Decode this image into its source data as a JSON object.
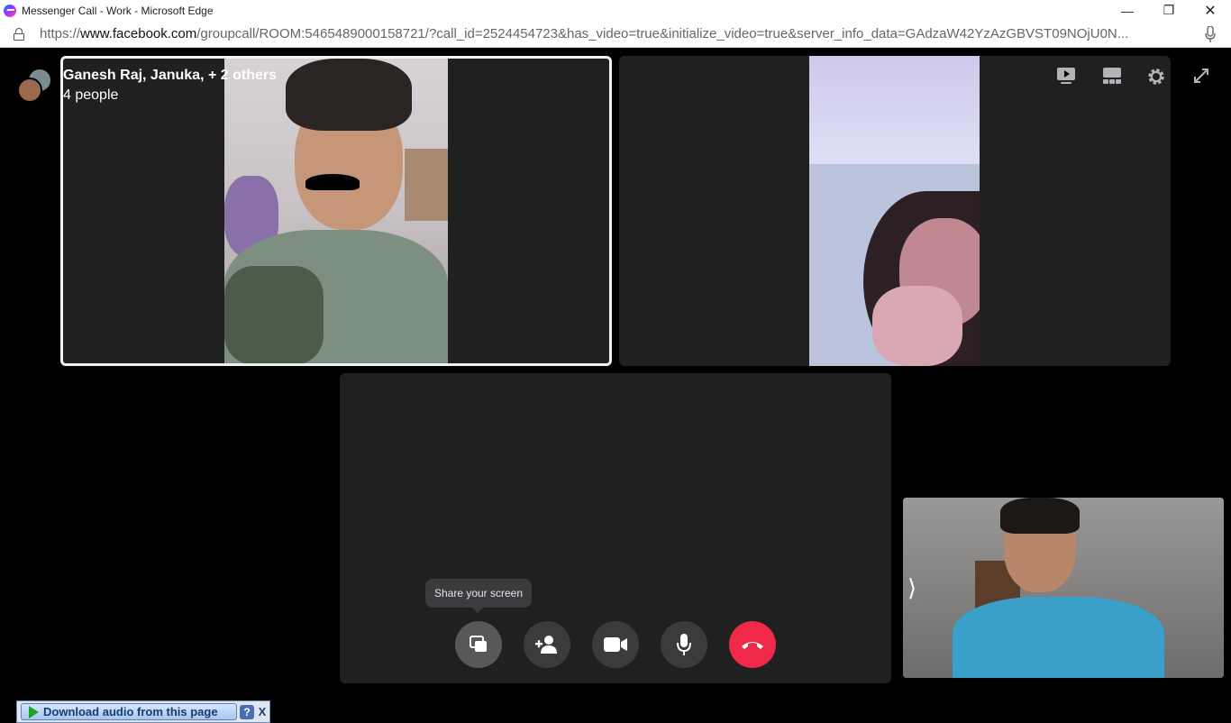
{
  "window": {
    "title": "Messenger Call - Work - Microsoft Edge",
    "min_glyph": "—",
    "max_glyph": "❐",
    "close_glyph": "✕"
  },
  "address": {
    "scheme": "https://",
    "host": "www.facebook.com",
    "path": "/groupcall/ROOM:5465489000158721/?call_id=2524454723&has_video=true&initialize_video=true&server_info_data=GAdzaW42YzAzGBVST09NOjU0N..."
  },
  "call": {
    "participants": "Ganesh Raj, Januka, + 2 others",
    "people_count": "4 people"
  },
  "tooltip": "Share your screen",
  "controls": {
    "share": "share-screen",
    "add": "add-person",
    "video": "camera",
    "mic": "microphone",
    "end": "end-call"
  },
  "self_view": {
    "toggle_glyph": "⟩"
  },
  "download_bar": {
    "label": "Download audio from this page",
    "help": "?",
    "close": "X"
  },
  "colors": {
    "end_call": "#f02849",
    "control_bg": "#3a3b3c",
    "active_border": "#f2f2f2"
  }
}
